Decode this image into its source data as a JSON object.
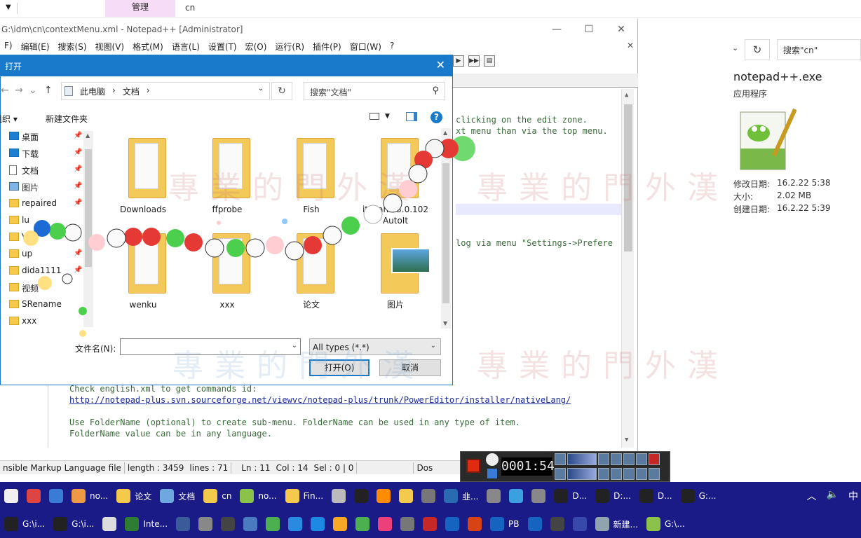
{
  "explorer": {
    "ribbon_manage": "管理",
    "folder_title": "cn",
    "search_placeholder": "搜索\"cn\"",
    "details": {
      "file_name": "notepad++.exe",
      "file_type": "应用程序",
      "rows": [
        {
          "key": "修改日期:",
          "value": "16.2.22 5:38"
        },
        {
          "key": "大小:",
          "value": "2.02 MB"
        },
        {
          "key": "创建日期:",
          "value": "16.2.22 5:39"
        }
      ]
    }
  },
  "npp": {
    "title": "G:\\idm\\cn\\contextMenu.xml - Notepad++ [Administrator]",
    "menu": [
      "F)",
      "编辑(E)",
      "搜索(S)",
      "视图(V)",
      "格式(M)",
      "语言(L)",
      "设置(T)",
      "宏(O)",
      "运行(R)",
      "插件(P)",
      "窗口(W)",
      "?"
    ],
    "code_right": [
      "clicking on the edit zone.",
      "xt menu than via the top menu.",
      "log via menu \"Settings->Prefere"
    ],
    "code_bottom": [
      "Check english.xml to get commands id:",
      "http://notepad-plus.svn.sourceforge.net/viewvc/notepad-plus/trunk/PowerEditor/installer/nativeLang/",
      "Use FolderName (optional) to create sub-menu. FolderName can be used in any type of item.",
      "FolderName value can be in any language."
    ],
    "status": {
      "type": "nsible Markup Language file",
      "length": "length : 3459",
      "lines": "lines : 71",
      "ln": "Ln : 11",
      "col": "Col : 14",
      "sel": "Sel : 0 | 0",
      "eol": "Dos"
    }
  },
  "dialog": {
    "title": "打开",
    "breadcrumb": [
      "此电脑",
      "文档"
    ],
    "search_placeholder": "搜索\"文档\"",
    "organize": "组织",
    "new_folder": "新建文件夹",
    "sidebar": [
      {
        "label": "桌面",
        "icon": "blue"
      },
      {
        "label": "下载",
        "icon": "blue"
      },
      {
        "label": "文档",
        "icon": "doc"
      },
      {
        "label": "图片",
        "icon": "pic"
      },
      {
        "label": "repaired",
        "icon": "folder"
      },
      {
        "label": "lu",
        "icon": "folder"
      },
      {
        "label": "V",
        "icon": "folder"
      },
      {
        "label": "up",
        "icon": "folder"
      },
      {
        "label": "dida1111",
        "icon": "folder"
      },
      {
        "label": "视频",
        "icon": "folder"
      },
      {
        "label": "SRename",
        "icon": "folder"
      },
      {
        "label": "xxx",
        "icon": "folder"
      }
    ],
    "files": [
      {
        "label": "Downloads",
        "variant": "doc"
      },
      {
        "label": "ffprobe",
        "variant": "doc"
      },
      {
        "label": "Fish",
        "variant": "doc"
      },
      {
        "label": "italian-v3.0.102 AutoIt",
        "variant": "doc"
      },
      {
        "label": "wenku",
        "variant": "doc"
      },
      {
        "label": "xxx",
        "variant": "doc"
      },
      {
        "label": "论文",
        "variant": "doc"
      },
      {
        "label": "图片",
        "variant": "photo"
      }
    ],
    "filename_label": "文件名(N):",
    "filename_value": "",
    "filetype": "All types (*.*)",
    "open_button": "打开(O)",
    "cancel_button": "取消"
  },
  "watermark": "專業的門外漢",
  "recorder": {
    "timer": "0001:54"
  },
  "taskbar": {
    "row1": [
      {
        "label": "",
        "color": "#f0f0f0"
      },
      {
        "label": "",
        "color": "#d44"
      },
      {
        "label": "",
        "color": "#3a7bd5"
      },
      {
        "label": "no...",
        "color": "#e94"
      },
      {
        "label": "论文",
        "color": "#f5c94c"
      },
      {
        "label": "文档",
        "color": "#6fa8dc"
      },
      {
        "label": "cn",
        "color": "#f5c94c"
      },
      {
        "label": "no...",
        "color": "#8bc34a"
      },
      {
        "label": "Fin...",
        "color": "#f5c94c"
      },
      {
        "label": "",
        "color": "#bbb"
      },
      {
        "label": "",
        "color": "#222"
      },
      {
        "label": "",
        "color": "#ff8c00"
      },
      {
        "label": "",
        "color": "#f5c94c"
      },
      {
        "label": "",
        "color": "#777"
      },
      {
        "label": "韭...",
        "color": "#2a6ab0"
      },
      {
        "label": "",
        "color": "#888"
      },
      {
        "label": "",
        "color": "#3aa0e0"
      },
      {
        "label": "",
        "color": "#888"
      },
      {
        "label": "D...",
        "color": "#222"
      },
      {
        "label": "D:...",
        "color": "#222"
      },
      {
        "label": "D...",
        "color": "#222"
      },
      {
        "label": "G:...",
        "color": "#222"
      }
    ],
    "row2": [
      {
        "label": "G:\\i...",
        "color": "#222"
      },
      {
        "label": "G:\\i...",
        "color": "#222"
      },
      {
        "label": "",
        "color": "#ddd"
      },
      {
        "label": "Inte...",
        "color": "#2e7d32"
      },
      {
        "label": "",
        "color": "#3a5a9a"
      },
      {
        "label": "",
        "color": "#888"
      },
      {
        "label": "",
        "color": "#444"
      },
      {
        "label": "",
        "color": "#4a7ac0"
      },
      {
        "label": "",
        "color": "#4caf50"
      },
      {
        "label": "",
        "color": "#2a8ae0"
      },
      {
        "label": "",
        "color": "#1e88e5"
      },
      {
        "label": "",
        "color": "#f9a825"
      },
      {
        "label": "",
        "color": "#4caf50"
      },
      {
        "label": "",
        "color": "#ec407a"
      },
      {
        "label": "",
        "color": "#777"
      },
      {
        "label": "",
        "color": "#c62828"
      },
      {
        "label": "",
        "color": "#1565c0"
      },
      {
        "label": "",
        "color": "#d84315"
      },
      {
        "label": "PB",
        "color": "#1565c0"
      },
      {
        "label": "",
        "color": "#1565c0"
      },
      {
        "label": "",
        "color": "#444"
      },
      {
        "label": "",
        "color": "#3949ab"
      },
      {
        "label": "新建...",
        "color": "#90a4ae"
      },
      {
        "label": "G:\\...",
        "color": "#8bc34a"
      }
    ],
    "tray_time_hint": "中"
  }
}
